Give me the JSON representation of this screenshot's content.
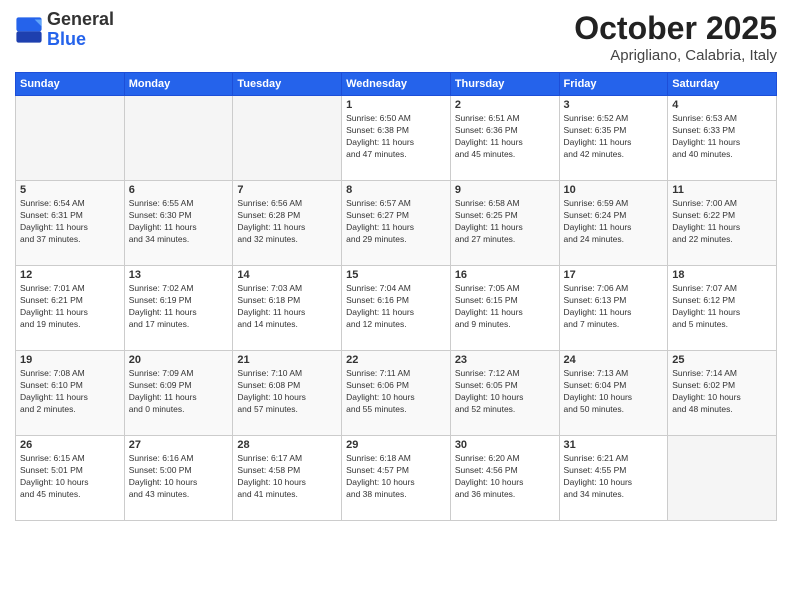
{
  "header": {
    "logo_general": "General",
    "logo_blue": "Blue",
    "month": "October 2025",
    "location": "Aprigliano, Calabria, Italy"
  },
  "weekdays": [
    "Sunday",
    "Monday",
    "Tuesday",
    "Wednesday",
    "Thursday",
    "Friday",
    "Saturday"
  ],
  "weeks": [
    [
      {
        "day": "",
        "info": ""
      },
      {
        "day": "",
        "info": ""
      },
      {
        "day": "",
        "info": ""
      },
      {
        "day": "1",
        "info": "Sunrise: 6:50 AM\nSunset: 6:38 PM\nDaylight: 11 hours\nand 47 minutes."
      },
      {
        "day": "2",
        "info": "Sunrise: 6:51 AM\nSunset: 6:36 PM\nDaylight: 11 hours\nand 45 minutes."
      },
      {
        "day": "3",
        "info": "Sunrise: 6:52 AM\nSunset: 6:35 PM\nDaylight: 11 hours\nand 42 minutes."
      },
      {
        "day": "4",
        "info": "Sunrise: 6:53 AM\nSunset: 6:33 PM\nDaylight: 11 hours\nand 40 minutes."
      }
    ],
    [
      {
        "day": "5",
        "info": "Sunrise: 6:54 AM\nSunset: 6:31 PM\nDaylight: 11 hours\nand 37 minutes."
      },
      {
        "day": "6",
        "info": "Sunrise: 6:55 AM\nSunset: 6:30 PM\nDaylight: 11 hours\nand 34 minutes."
      },
      {
        "day": "7",
        "info": "Sunrise: 6:56 AM\nSunset: 6:28 PM\nDaylight: 11 hours\nand 32 minutes."
      },
      {
        "day": "8",
        "info": "Sunrise: 6:57 AM\nSunset: 6:27 PM\nDaylight: 11 hours\nand 29 minutes."
      },
      {
        "day": "9",
        "info": "Sunrise: 6:58 AM\nSunset: 6:25 PM\nDaylight: 11 hours\nand 27 minutes."
      },
      {
        "day": "10",
        "info": "Sunrise: 6:59 AM\nSunset: 6:24 PM\nDaylight: 11 hours\nand 24 minutes."
      },
      {
        "day": "11",
        "info": "Sunrise: 7:00 AM\nSunset: 6:22 PM\nDaylight: 11 hours\nand 22 minutes."
      }
    ],
    [
      {
        "day": "12",
        "info": "Sunrise: 7:01 AM\nSunset: 6:21 PM\nDaylight: 11 hours\nand 19 minutes."
      },
      {
        "day": "13",
        "info": "Sunrise: 7:02 AM\nSunset: 6:19 PM\nDaylight: 11 hours\nand 17 minutes."
      },
      {
        "day": "14",
        "info": "Sunrise: 7:03 AM\nSunset: 6:18 PM\nDaylight: 11 hours\nand 14 minutes."
      },
      {
        "day": "15",
        "info": "Sunrise: 7:04 AM\nSunset: 6:16 PM\nDaylight: 11 hours\nand 12 minutes."
      },
      {
        "day": "16",
        "info": "Sunrise: 7:05 AM\nSunset: 6:15 PM\nDaylight: 11 hours\nand 9 minutes."
      },
      {
        "day": "17",
        "info": "Sunrise: 7:06 AM\nSunset: 6:13 PM\nDaylight: 11 hours\nand 7 minutes."
      },
      {
        "day": "18",
        "info": "Sunrise: 7:07 AM\nSunset: 6:12 PM\nDaylight: 11 hours\nand 5 minutes."
      }
    ],
    [
      {
        "day": "19",
        "info": "Sunrise: 7:08 AM\nSunset: 6:10 PM\nDaylight: 11 hours\nand 2 minutes."
      },
      {
        "day": "20",
        "info": "Sunrise: 7:09 AM\nSunset: 6:09 PM\nDaylight: 11 hours\nand 0 minutes."
      },
      {
        "day": "21",
        "info": "Sunrise: 7:10 AM\nSunset: 6:08 PM\nDaylight: 10 hours\nand 57 minutes."
      },
      {
        "day": "22",
        "info": "Sunrise: 7:11 AM\nSunset: 6:06 PM\nDaylight: 10 hours\nand 55 minutes."
      },
      {
        "day": "23",
        "info": "Sunrise: 7:12 AM\nSunset: 6:05 PM\nDaylight: 10 hours\nand 52 minutes."
      },
      {
        "day": "24",
        "info": "Sunrise: 7:13 AM\nSunset: 6:04 PM\nDaylight: 10 hours\nand 50 minutes."
      },
      {
        "day": "25",
        "info": "Sunrise: 7:14 AM\nSunset: 6:02 PM\nDaylight: 10 hours\nand 48 minutes."
      }
    ],
    [
      {
        "day": "26",
        "info": "Sunrise: 6:15 AM\nSunset: 5:01 PM\nDaylight: 10 hours\nand 45 minutes."
      },
      {
        "day": "27",
        "info": "Sunrise: 6:16 AM\nSunset: 5:00 PM\nDaylight: 10 hours\nand 43 minutes."
      },
      {
        "day": "28",
        "info": "Sunrise: 6:17 AM\nSunset: 4:58 PM\nDaylight: 10 hours\nand 41 minutes."
      },
      {
        "day": "29",
        "info": "Sunrise: 6:18 AM\nSunset: 4:57 PM\nDaylight: 10 hours\nand 38 minutes."
      },
      {
        "day": "30",
        "info": "Sunrise: 6:20 AM\nSunset: 4:56 PM\nDaylight: 10 hours\nand 36 minutes."
      },
      {
        "day": "31",
        "info": "Sunrise: 6:21 AM\nSunset: 4:55 PM\nDaylight: 10 hours\nand 34 minutes."
      },
      {
        "day": "",
        "info": ""
      }
    ]
  ]
}
